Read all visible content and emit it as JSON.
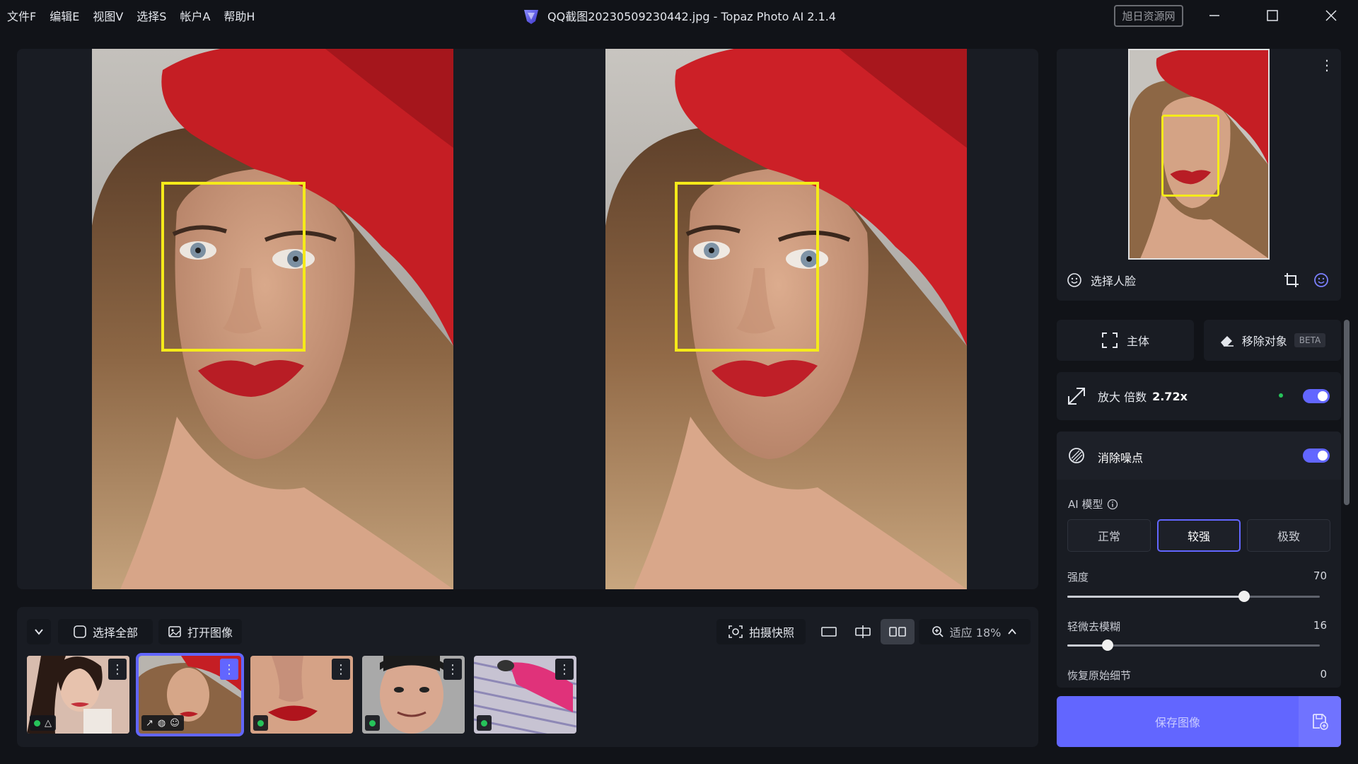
{
  "menu": [
    "文件F",
    "编辑E",
    "视图V",
    "选择S",
    "帐户A",
    "帮助H"
  ],
  "window": {
    "title": "QQ截图20230509230442.jpg - Topaz Photo AI 2.1.4",
    "watermark": "旭日资源网"
  },
  "toolbar": {
    "select_all": "选择全部",
    "open_image": "打开图像",
    "snapshot": "拍摄快照",
    "zoom": "适应 18%"
  },
  "preview": {
    "select_face": "选择人脸"
  },
  "tools": {
    "subject": "主体",
    "remove": "移除对象",
    "remove_badge": "BETA",
    "upscale_label": "放大 倍数",
    "upscale_value": "2.72x",
    "denoise_label": "消除噪点"
  },
  "denoise": {
    "ai_model_label": "AI 模型",
    "models": [
      "正常",
      "较强",
      "极致"
    ],
    "selected_model": "较强",
    "strength_label": "强度",
    "strength_value": "70",
    "strength_fraction": 0.7,
    "deblur_label": "轻微去模糊",
    "deblur_value": "16",
    "deblur_fraction": 0.16,
    "detail_label": "恢复原始细节",
    "detail_value": "0"
  },
  "save": {
    "label": "保存图像"
  },
  "colors": {
    "accent": "#6266ff",
    "facebox": "#f5ea1a",
    "panel": "#191c23",
    "bg": "#111318"
  }
}
